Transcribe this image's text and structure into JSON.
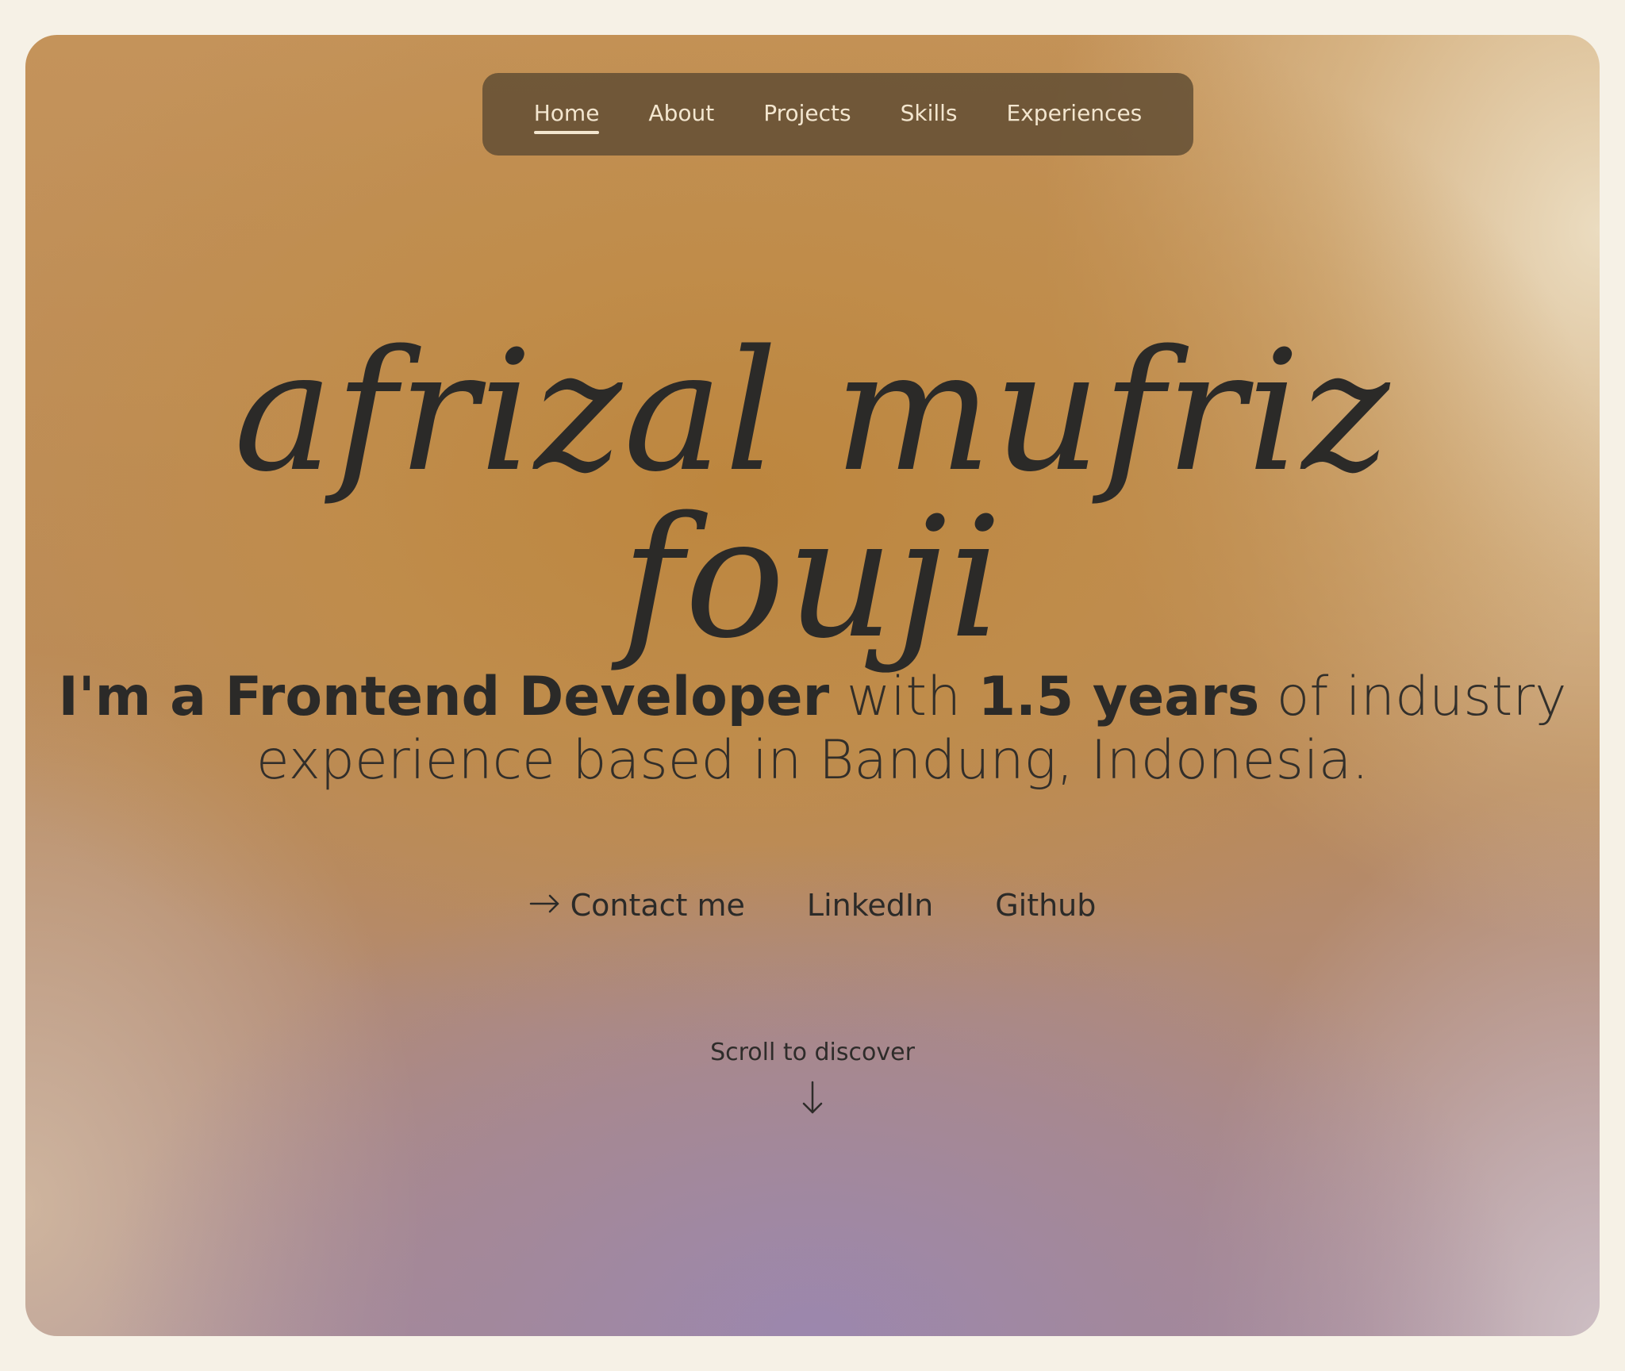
{
  "nav": {
    "items": [
      {
        "label": "Home",
        "active": true
      },
      {
        "label": "About",
        "active": false
      },
      {
        "label": "Projects",
        "active": false
      },
      {
        "label": "Skills",
        "active": false
      },
      {
        "label": "Experiences",
        "active": false
      }
    ]
  },
  "hero": {
    "name": "afrizal mufriz fouji"
  },
  "intro": {
    "prefix": "I'm a Frontend Developer",
    "with": " with ",
    "years": "1.5 years",
    "rest1": " of industry",
    "line2": "experience based in Bandung, Indonesia."
  },
  "links": {
    "contact_icon": "arrow-right-icon",
    "contact": "Contact me",
    "linkedin": "LinkedIn",
    "github": "Github"
  },
  "scroll": {
    "label": "Scroll to discover",
    "icon": "arrow-down-icon"
  },
  "colors": {
    "page_bg": "#f6f1e6",
    "nav_bg": "#624e34",
    "nav_text": "#f3e6cf",
    "text_dark": "#2b2a28"
  }
}
